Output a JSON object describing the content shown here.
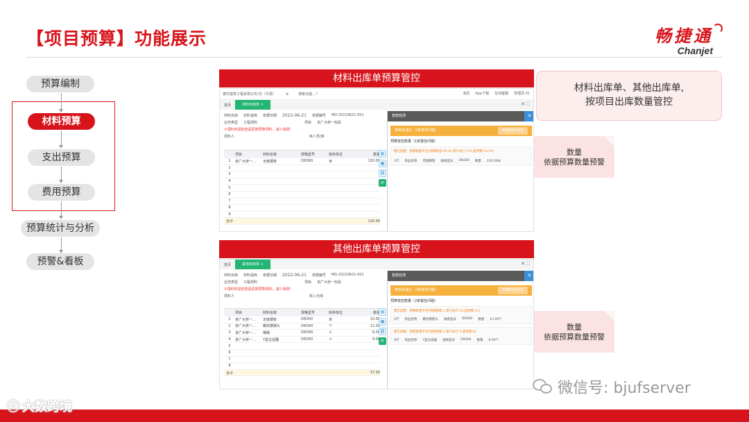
{
  "header": {
    "title": "【项目预算】功能展示",
    "brand_cn": "畅捷通",
    "brand_en": "Chanjet"
  },
  "flow": {
    "steps": [
      "预算编制",
      "材料预算",
      "支出预算",
      "费用预算",
      "预算统计与分析",
      "预警&看板"
    ],
    "active": "材料预算"
  },
  "screen1": {
    "banner": "材料出库单预算管控",
    "company": "德华建筑工程有限公司-刘（华源）",
    "search": "搜索功能…？",
    "top_right": [
      "消息",
      "App下载",
      "在线客服",
      "管理员-刘"
    ],
    "home_tab": "首页",
    "doc_tab": "材料出库单 ×",
    "radio1": "材料出库",
    "radio2": "材料退库",
    "date_label": "单据日期",
    "date": "2022-06-21",
    "no_label": "单据编号",
    "doc_no": "MD-20220621-001",
    "biz_type_label": "业务类型",
    "biz_type": "工程领料",
    "project_label": "项目",
    "project": "京广大桥一标段",
    "warn_text": "①领料时请检查是否按预算领料，减少浪费！",
    "handler_label": "领料人",
    "handler": "",
    "storekeeper_label": "库人员/库",
    "storekeeper": "",
    "columns": [
      "",
      "项目",
      "材料名称",
      "规格型号",
      "库存单位",
      "数量"
    ],
    "rows": [
      {
        "n": "1",
        "proj": "京广大桥一…",
        "mat": "无缝钢管",
        "spec": "DN300",
        "unit": "米",
        "qty": "120.00"
      },
      {
        "n": "2",
        "proj": "",
        "mat": "",
        "spec": "",
        "unit": "",
        "qty": ""
      },
      {
        "n": "3",
        "proj": "",
        "mat": "",
        "spec": "",
        "unit": "",
        "qty": ""
      },
      {
        "n": "4",
        "proj": "",
        "mat": "",
        "spec": "",
        "unit": "",
        "qty": ""
      },
      {
        "n": "5",
        "proj": "",
        "mat": "",
        "spec": "",
        "unit": "",
        "qty": ""
      },
      {
        "n": "6",
        "proj": "",
        "mat": "",
        "spec": "",
        "unit": "",
        "qty": ""
      },
      {
        "n": "7",
        "proj": "",
        "mat": "",
        "spec": "",
        "unit": "",
        "qty": ""
      },
      {
        "n": "8",
        "proj": "",
        "mat": "",
        "spec": "",
        "unit": "",
        "qty": ""
      },
      {
        "n": "9",
        "proj": "",
        "mat": "",
        "spec": "",
        "unit": "",
        "qty": ""
      }
    ],
    "total_label": "合计",
    "total": "120.00",
    "panel": {
      "title": "智能检测",
      "warn_title": "审核未通过（1条警告问题）",
      "warn_btn": "忽略警告并保存",
      "section": "预算管控数量（1条警告问题）",
      "card_head": "警告提醒：预算数量不足(预算数量:60.00,累计执行:125,超预算:10.00)",
      "card_row": "1行",
      "card_name_label": "商品名称",
      "card_name": "无缝钢管",
      "card_spec_label": "规格型号",
      "card_spec": "DN300",
      "card_qty_label": "数量",
      "card_qty": "120.00米"
    }
  },
  "screen2": {
    "banner": "其他出库单预算管控",
    "home_tab": "首页",
    "doc_tab": "其他出库单 ×",
    "radio1": "材料出库",
    "radio2": "材料退库",
    "date_label": "单据日期",
    "date": "2022-06-21",
    "no_label": "单据编号",
    "doc_no": "MD-20220621-001",
    "biz_type_label": "业务类型",
    "biz_type": "工程领料",
    "project_label": "项目",
    "project": "京广大桥一标段",
    "warn_text": "①领料时请检查是否按预算领料，减少浪费！",
    "handler_label": "领料人",
    "storekeeper_label": "收入仓库",
    "columns": [
      "",
      "项目",
      "材料名称",
      "规格型号",
      "库存单位",
      "数量"
    ],
    "rows": [
      {
        "n": "1",
        "proj": "京广大桥一…",
        "mat": "无缝钢管",
        "spec": "DN300",
        "unit": "米",
        "qty": "10.00"
      },
      {
        "n": "2",
        "proj": "京广大桥一…",
        "mat": "螺纹钢接头",
        "spec": "DN300",
        "unit": "个",
        "qty": "12.00"
      },
      {
        "n": "3",
        "proj": "京广大桥一…",
        "mat": "钢绳",
        "spec": "DN300",
        "unit": "个",
        "qty": "6.00"
      },
      {
        "n": "4",
        "proj": "京广大桥一…",
        "mat": "Y型过滤器",
        "spec": "DN300",
        "unit": "个",
        "qty": "9.00"
      },
      {
        "n": "5",
        "proj": "",
        "mat": "",
        "spec": "",
        "unit": "",
        "qty": ""
      },
      {
        "n": "6",
        "proj": "",
        "mat": "",
        "spec": "",
        "unit": "",
        "qty": ""
      },
      {
        "n": "7",
        "proj": "",
        "mat": "",
        "spec": "",
        "unit": "",
        "qty": ""
      },
      {
        "n": "8",
        "proj": "",
        "mat": "",
        "spec": "",
        "unit": "",
        "qty": ""
      }
    ],
    "total_label": "合计",
    "total": "37.00",
    "panel": {
      "title": "智能检测",
      "warn_title": "审核未通过（2条警告问题）",
      "warn_btn": "忽略警告并保存",
      "section": "预算管控数量（2条警告问题）",
      "cards": [
        {
          "head": "警告提醒：预算数量不足(预算数量:1,累计执行:10,超预算:12)",
          "row": "2行",
          "name_label": "商品名称",
          "name": "螺纹钢接头",
          "spec_label": "规格型号",
          "spec": "DN300",
          "qty_label": "数量",
          "qty": "12.00个"
        },
        {
          "head": "警告提醒：预算数量不足(预算数量:1,累计执行:0,超预算:8)",
          "row": "4行",
          "name_label": "商品名称",
          "name": "Y型过滤器",
          "spec_label": "规格型号",
          "spec": "DN300",
          "qty_label": "数量",
          "qty": "8.00个"
        }
      ]
    }
  },
  "callout_main": {
    "line1": "材料出库单、其他出库单,",
    "line2": "按项目出库数量管控"
  },
  "tag1": {
    "line1": "数量",
    "line2": "依据预算数量预警"
  },
  "tag2": {
    "line1": "数量",
    "line2": "依据预算数量预警"
  },
  "watermark": "微信号: bjufserver",
  "bottom_watermark": "大数跨境",
  "colors": {
    "brand_red": "#d7141c",
    "green_tab": "#22b573",
    "warn_orange": "#f6b13c",
    "pill_gray": "#e4e4e4"
  }
}
